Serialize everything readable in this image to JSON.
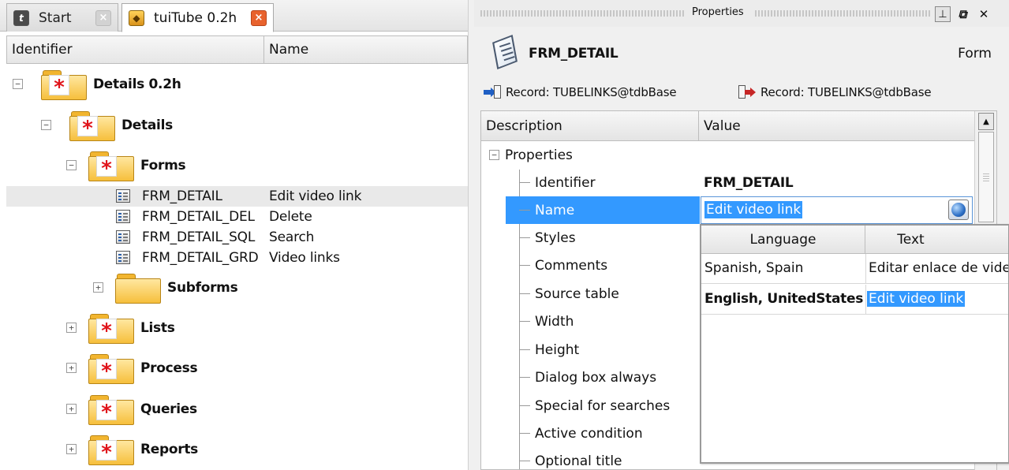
{
  "tabs": {
    "start": {
      "label": "Start",
      "icon": "start-icon"
    },
    "active": {
      "label": "tuiTube 0.2h",
      "icon": "tuitube-icon"
    }
  },
  "tree": {
    "columns": {
      "identifier": "Identifier",
      "name": "Name"
    },
    "root": "Details 0.2h",
    "details": "Details",
    "forms_label": "Forms",
    "forms": [
      {
        "id": "FRM_DETAIL",
        "name": "Edit video link"
      },
      {
        "id": "FRM_DETAIL_DEL",
        "name": "Delete"
      },
      {
        "id": "FRM_DETAIL_SQL",
        "name": "Search"
      },
      {
        "id": "FRM_DETAIL_GRD",
        "name": "Video links"
      }
    ],
    "subforms": "Subforms",
    "lists": "Lists",
    "process": "Process",
    "queries": "Queries",
    "reports": "Reports"
  },
  "properties_panel": {
    "title": "Properties",
    "object_name": "FRM_DETAIL",
    "object_type": "Form",
    "record_in": "Record: TUBELINKS@tdbBase",
    "record_out": "Record: TUBELINKS@tdbBase",
    "columns": {
      "description": "Description",
      "value": "Value"
    },
    "group": "Properties",
    "rows": [
      {
        "desc": "Identifier",
        "value": "FRM_DETAIL"
      },
      {
        "desc": "Name",
        "value": "Edit video link"
      },
      {
        "desc": "Styles",
        "value": ""
      },
      {
        "desc": "Comments",
        "value": ""
      },
      {
        "desc": "Source table",
        "value": ""
      },
      {
        "desc": "Width",
        "value": ""
      },
      {
        "desc": "Height",
        "value": ""
      },
      {
        "desc": "Dialog box always",
        "value": ""
      },
      {
        "desc": "Special for searches",
        "value": ""
      },
      {
        "desc": "Active condition",
        "value": ""
      },
      {
        "desc": "Optional title",
        "value": ""
      }
    ]
  },
  "translations": {
    "columns": {
      "language": "Language",
      "text": "Text"
    },
    "rows": [
      {
        "language": "Spanish, Spain",
        "text": "Editar enlace de video"
      },
      {
        "language": "English, UnitedStates",
        "text": "Edit video link"
      }
    ]
  },
  "colors": {
    "selection": "#3399ff",
    "folder": "#f6bf3c",
    "star": "#e0141b",
    "close_tab": "#e8622d"
  }
}
